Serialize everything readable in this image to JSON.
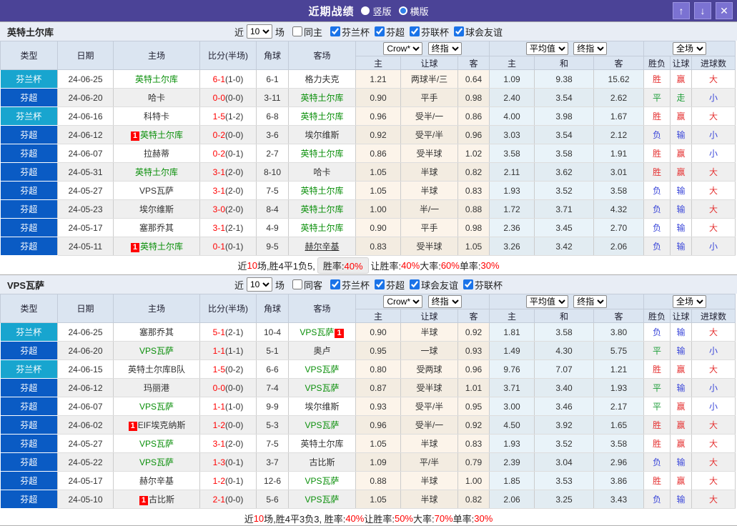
{
  "titlebar": {
    "title": "近期战绩",
    "vertical_label": "竖版",
    "horizontal_label": "横版",
    "buttons": {
      "up": "↑",
      "down": "↓",
      "close": "✕"
    }
  },
  "colors": {
    "titlebar": "#4b4397",
    "cup_badge": "#18a5cf",
    "league_badge": "#0a5bc4",
    "team_highlight_green": "#0a8f0a",
    "score_red": "#ff0000",
    "win_red": "#e53333",
    "draw_green": "#1f9e3a",
    "lose_blue": "#3a46d9",
    "checkbox_accent": "#1a73e8"
  },
  "columns": {
    "type": "类型",
    "date": "日期",
    "home": "主场",
    "score": "比分(半场)",
    "corner": "角球",
    "away": "客场",
    "h": "主",
    "handicap": "让球",
    "a": "客",
    "avg_h": "主",
    "avg_d": "和",
    "avg_a": "客",
    "wdl": "胜负",
    "let_result": "让球",
    "goals": "进球数"
  },
  "header_selects": {
    "source": "Crow*",
    "source_time": "终指",
    "avg": "平均值",
    "avg_time": "终指",
    "scope": "全场"
  },
  "tables": [
    {
      "team": "英特土尔库",
      "filter": {
        "near_label": "近",
        "count": "10",
        "games_label": "场",
        "same_venue_label": "同主",
        "same_venue_checked": false,
        "leagues": [
          {
            "label": "芬兰杯",
            "checked": true
          },
          {
            "label": "芬超",
            "checked": true
          },
          {
            "label": "芬联杯",
            "checked": true
          },
          {
            "label": "球会友谊",
            "checked": true
          }
        ]
      },
      "rows": [
        {
          "type": "芬兰杯",
          "type_style": "cup",
          "date": "24-06-25",
          "home": {
            "name": "英特土尔库",
            "green": true
          },
          "score_ft": "6-1",
          "score_ht": "(1-0)",
          "corner": "6-1",
          "away": {
            "name": "格力夫克"
          },
          "odds": [
            "1.21",
            "两球半/三",
            "0.64"
          ],
          "avg": [
            "1.09",
            "9.38",
            "15.62"
          ],
          "results": [
            [
              "胜",
              "r"
            ],
            [
              "赢",
              "r"
            ],
            [
              "大",
              "r"
            ]
          ]
        },
        {
          "type": "芬超",
          "type_style": "league",
          "date": "24-06-20",
          "home": {
            "name": "哈卡"
          },
          "score_ft": "0-0",
          "score_ht": "(0-0)",
          "corner": "3-11",
          "away": {
            "name": "英特土尔库",
            "green": true
          },
          "odds": [
            "0.90",
            "平手",
            "0.98"
          ],
          "avg": [
            "2.40",
            "3.54",
            "2.62"
          ],
          "results": [
            [
              "平",
              "g"
            ],
            [
              "走",
              "g"
            ],
            [
              "小",
              "b"
            ]
          ]
        },
        {
          "type": "芬兰杯",
          "type_style": "cup",
          "date": "24-06-16",
          "home": {
            "name": "科特卡"
          },
          "score_ft": "1-5",
          "score_ht": "(1-2)",
          "corner": "6-8",
          "away": {
            "name": "英特土尔库",
            "green": true
          },
          "odds": [
            "0.96",
            "受半/一",
            "0.86"
          ],
          "avg": [
            "4.00",
            "3.98",
            "1.67"
          ],
          "results": [
            [
              "胜",
              "r"
            ],
            [
              "赢",
              "r"
            ],
            [
              "大",
              "r"
            ]
          ]
        },
        {
          "type": "芬超",
          "type_style": "league",
          "date": "24-06-12",
          "home": {
            "name": "英特土尔库",
            "green": true,
            "badge": "1"
          },
          "score_ft": "0-2",
          "score_ht": "(0-0)",
          "corner": "3-6",
          "away": {
            "name": "埃尔维斯"
          },
          "odds": [
            "0.92",
            "受平/半",
            "0.96"
          ],
          "avg": [
            "3.03",
            "3.54",
            "2.12"
          ],
          "results": [
            [
              "负",
              "b"
            ],
            [
              "输",
              "b"
            ],
            [
              "小",
              "b"
            ]
          ]
        },
        {
          "type": "芬超",
          "type_style": "league",
          "date": "24-06-07",
          "home": {
            "name": "拉赫蒂"
          },
          "score_ft": "0-2",
          "score_ht": "(0-1)",
          "corner": "2-7",
          "away": {
            "name": "英特土尔库",
            "green": true
          },
          "odds": [
            "0.86",
            "受半球",
            "1.02"
          ],
          "avg": [
            "3.58",
            "3.58",
            "1.91"
          ],
          "results": [
            [
              "胜",
              "r"
            ],
            [
              "赢",
              "r"
            ],
            [
              "小",
              "b"
            ]
          ]
        },
        {
          "type": "芬超",
          "type_style": "league",
          "date": "24-05-31",
          "home": {
            "name": "英特土尔库",
            "green": true
          },
          "score_ft": "3-1",
          "score_ht": "(2-0)",
          "corner": "8-10",
          "away": {
            "name": "哈卡"
          },
          "odds": [
            "1.05",
            "半球",
            "0.82"
          ],
          "avg": [
            "2.11",
            "3.62",
            "3.01"
          ],
          "results": [
            [
              "胜",
              "r"
            ],
            [
              "赢",
              "r"
            ],
            [
              "大",
              "r"
            ]
          ]
        },
        {
          "type": "芬超",
          "type_style": "league",
          "date": "24-05-27",
          "home": {
            "name": "VPS瓦萨"
          },
          "score_ft": "3-1",
          "score_ht": "(2-0)",
          "corner": "7-5",
          "away": {
            "name": "英特土尔库",
            "green": true
          },
          "odds": [
            "1.05",
            "半球",
            "0.83"
          ],
          "avg": [
            "1.93",
            "3.52",
            "3.58"
          ],
          "results": [
            [
              "负",
              "b"
            ],
            [
              "输",
              "b"
            ],
            [
              "大",
              "r"
            ]
          ]
        },
        {
          "type": "芬超",
          "type_style": "league",
          "date": "24-05-23",
          "home": {
            "name": "埃尔维斯"
          },
          "score_ft": "3-0",
          "score_ht": "(2-0)",
          "corner": "8-4",
          "away": {
            "name": "英特土尔库",
            "green": true
          },
          "odds": [
            "1.00",
            "半/一",
            "0.88"
          ],
          "avg": [
            "1.72",
            "3.71",
            "4.32"
          ],
          "results": [
            [
              "负",
              "b"
            ],
            [
              "输",
              "b"
            ],
            [
              "大",
              "r"
            ]
          ]
        },
        {
          "type": "芬超",
          "type_style": "league",
          "date": "24-05-17",
          "home": {
            "name": "塞那乔其"
          },
          "score_ft": "3-1",
          "score_ht": "(2-1)",
          "corner": "4-9",
          "away": {
            "name": "英特土尔库",
            "green": true
          },
          "odds": [
            "0.90",
            "平手",
            "0.98"
          ],
          "avg": [
            "2.36",
            "3.45",
            "2.70"
          ],
          "results": [
            [
              "负",
              "b"
            ],
            [
              "输",
              "b"
            ],
            [
              "大",
              "r"
            ]
          ]
        },
        {
          "type": "芬超",
          "type_style": "league",
          "date": "24-05-11",
          "home": {
            "name": "英特土尔库",
            "green": true,
            "badge": "1"
          },
          "score_ft": "0-1",
          "score_ht": "(0-1)",
          "corner": "9-5",
          "away": {
            "name": "赫尔辛基",
            "underline": true
          },
          "odds": [
            "0.83",
            "受半球",
            "1.05"
          ],
          "avg": [
            "3.26",
            "3.42",
            "2.06"
          ],
          "results": [
            [
              "负",
              "b"
            ],
            [
              "输",
              "b"
            ],
            [
              "小",
              "b"
            ]
          ]
        }
      ],
      "summary": [
        {
          "text": "近"
        },
        {
          "text": "10",
          "red": true
        },
        {
          "text": "场,胜4平1负5, "
        },
        {
          "box": [
            {
              "text": "胜率:"
            },
            {
              "text": "40%",
              "red": true
            }
          ]
        },
        {
          "text": " 让胜率:"
        },
        {
          "text": "40%",
          "red": true
        },
        {
          "text": " 大率:"
        },
        {
          "text": "60%",
          "red": true
        },
        {
          "text": " 单率:"
        },
        {
          "text": "30%",
          "red": true
        }
      ]
    },
    {
      "team": "VPS瓦萨",
      "filter": {
        "near_label": "近",
        "count": "10",
        "games_label": "场",
        "same_venue_label": "同客",
        "same_venue_checked": false,
        "leagues": [
          {
            "label": "芬兰杯",
            "checked": true
          },
          {
            "label": "芬超",
            "checked": true
          },
          {
            "label": "球会友谊",
            "checked": true
          },
          {
            "label": "芬联杯",
            "checked": true
          }
        ]
      },
      "rows": [
        {
          "type": "芬兰杯",
          "type_style": "cup",
          "date": "24-06-25",
          "home": {
            "name": "塞那乔其"
          },
          "score_ft": "5-1",
          "score_ht": "(2-1)",
          "corner": "10-4",
          "away": {
            "name": "VPS瓦萨",
            "green": true,
            "badge": "1",
            "badge_after": true
          },
          "odds": [
            "0.90",
            "半球",
            "0.92"
          ],
          "avg": [
            "1.81",
            "3.58",
            "3.80"
          ],
          "results": [
            [
              "负",
              "b"
            ],
            [
              "输",
              "b"
            ],
            [
              "大",
              "r"
            ]
          ]
        },
        {
          "type": "芬超",
          "type_style": "league",
          "date": "24-06-20",
          "home": {
            "name": "VPS瓦萨",
            "green": true
          },
          "score_ft": "1-1",
          "score_ht": "(1-1)",
          "corner": "5-1",
          "away": {
            "name": "奥卢"
          },
          "odds": [
            "0.95",
            "一球",
            "0.93"
          ],
          "avg": [
            "1.49",
            "4.30",
            "5.75"
          ],
          "results": [
            [
              "平",
              "g"
            ],
            [
              "输",
              "b"
            ],
            [
              "小",
              "b"
            ]
          ]
        },
        {
          "type": "芬兰杯",
          "type_style": "cup",
          "date": "24-06-15",
          "home": {
            "name": "英特土尔库B队"
          },
          "score_ft": "1-5",
          "score_ht": "(0-2)",
          "corner": "6-6",
          "away": {
            "name": "VPS瓦萨",
            "green": true
          },
          "odds": [
            "0.80",
            "受两球",
            "0.96"
          ],
          "avg": [
            "9.76",
            "7.07",
            "1.21"
          ],
          "results": [
            [
              "胜",
              "r"
            ],
            [
              "赢",
              "r"
            ],
            [
              "大",
              "r"
            ]
          ]
        },
        {
          "type": "芬超",
          "type_style": "league",
          "date": "24-06-12",
          "home": {
            "name": "玛丽港"
          },
          "score_ft": "0-0",
          "score_ht": "(0-0)",
          "corner": "7-4",
          "away": {
            "name": "VPS瓦萨",
            "green": true
          },
          "odds": [
            "0.87",
            "受半球",
            "1.01"
          ],
          "avg": [
            "3.71",
            "3.40",
            "1.93"
          ],
          "results": [
            [
              "平",
              "g"
            ],
            [
              "输",
              "b"
            ],
            [
              "小",
              "b"
            ]
          ]
        },
        {
          "type": "芬超",
          "type_style": "league",
          "date": "24-06-07",
          "home": {
            "name": "VPS瓦萨",
            "green": true
          },
          "score_ft": "1-1",
          "score_ht": "(1-0)",
          "corner": "9-9",
          "away": {
            "name": "埃尔维斯"
          },
          "odds": [
            "0.93",
            "受平/半",
            "0.95"
          ],
          "avg": [
            "3.00",
            "3.46",
            "2.17"
          ],
          "results": [
            [
              "平",
              "g"
            ],
            [
              "赢",
              "r"
            ],
            [
              "小",
              "b"
            ]
          ]
        },
        {
          "type": "芬超",
          "type_style": "league",
          "date": "24-06-02",
          "home": {
            "name": "EIF埃克纳斯",
            "badge": "1"
          },
          "score_ft": "1-2",
          "score_ht": "(0-0)",
          "corner": "5-3",
          "away": {
            "name": "VPS瓦萨",
            "green": true
          },
          "odds": [
            "0.96",
            "受半/一",
            "0.92"
          ],
          "avg": [
            "4.50",
            "3.92",
            "1.65"
          ],
          "results": [
            [
              "胜",
              "r"
            ],
            [
              "赢",
              "r"
            ],
            [
              "大",
              "r"
            ]
          ]
        },
        {
          "type": "芬超",
          "type_style": "league",
          "date": "24-05-27",
          "home": {
            "name": "VPS瓦萨",
            "green": true
          },
          "score_ft": "3-1",
          "score_ht": "(2-0)",
          "corner": "7-5",
          "away": {
            "name": "英特土尔库"
          },
          "odds": [
            "1.05",
            "半球",
            "0.83"
          ],
          "avg": [
            "1.93",
            "3.52",
            "3.58"
          ],
          "results": [
            [
              "胜",
              "r"
            ],
            [
              "赢",
              "r"
            ],
            [
              "大",
              "r"
            ]
          ]
        },
        {
          "type": "芬超",
          "type_style": "league",
          "date": "24-05-22",
          "home": {
            "name": "VPS瓦萨",
            "green": true
          },
          "score_ft": "1-3",
          "score_ht": "(0-1)",
          "corner": "3-7",
          "away": {
            "name": "古比斯"
          },
          "odds": [
            "1.09",
            "平/半",
            "0.79"
          ],
          "avg": [
            "2.39",
            "3.04",
            "2.96"
          ],
          "results": [
            [
              "负",
              "b"
            ],
            [
              "输",
              "b"
            ],
            [
              "大",
              "r"
            ]
          ]
        },
        {
          "type": "芬超",
          "type_style": "league",
          "date": "24-05-17",
          "home": {
            "name": "赫尔辛基"
          },
          "score_ft": "1-2",
          "score_ht": "(0-1)",
          "corner": "12-6",
          "away": {
            "name": "VPS瓦萨",
            "green": true
          },
          "odds": [
            "0.88",
            "半球",
            "1.00"
          ],
          "avg": [
            "1.85",
            "3.53",
            "3.86"
          ],
          "results": [
            [
              "胜",
              "r"
            ],
            [
              "赢",
              "r"
            ],
            [
              "大",
              "r"
            ]
          ]
        },
        {
          "type": "芬超",
          "type_style": "league",
          "date": "24-05-10",
          "home": {
            "name": "古比斯",
            "badge": "1"
          },
          "score_ft": "2-1",
          "score_ht": "(0-0)",
          "corner": "5-6",
          "away": {
            "name": "VPS瓦萨",
            "green": true
          },
          "odds": [
            "1.05",
            "半球",
            "0.82"
          ],
          "avg": [
            "2.06",
            "3.25",
            "3.43"
          ],
          "results": [
            [
              "负",
              "b"
            ],
            [
              "输",
              "b"
            ],
            [
              "大",
              "r"
            ]
          ]
        }
      ],
      "summary": [
        {
          "text": "近"
        },
        {
          "text": "10",
          "red": true
        },
        {
          "text": "场,胜4平3负3, 胜率:"
        },
        {
          "text": "40%",
          "red": true
        },
        {
          "text": " 让胜率:"
        },
        {
          "text": "50%",
          "red": true
        },
        {
          "text": " 大率:"
        },
        {
          "text": "70%",
          "red": true
        },
        {
          "text": " 单率:"
        },
        {
          "text": "30%",
          "red": true
        }
      ]
    }
  ]
}
